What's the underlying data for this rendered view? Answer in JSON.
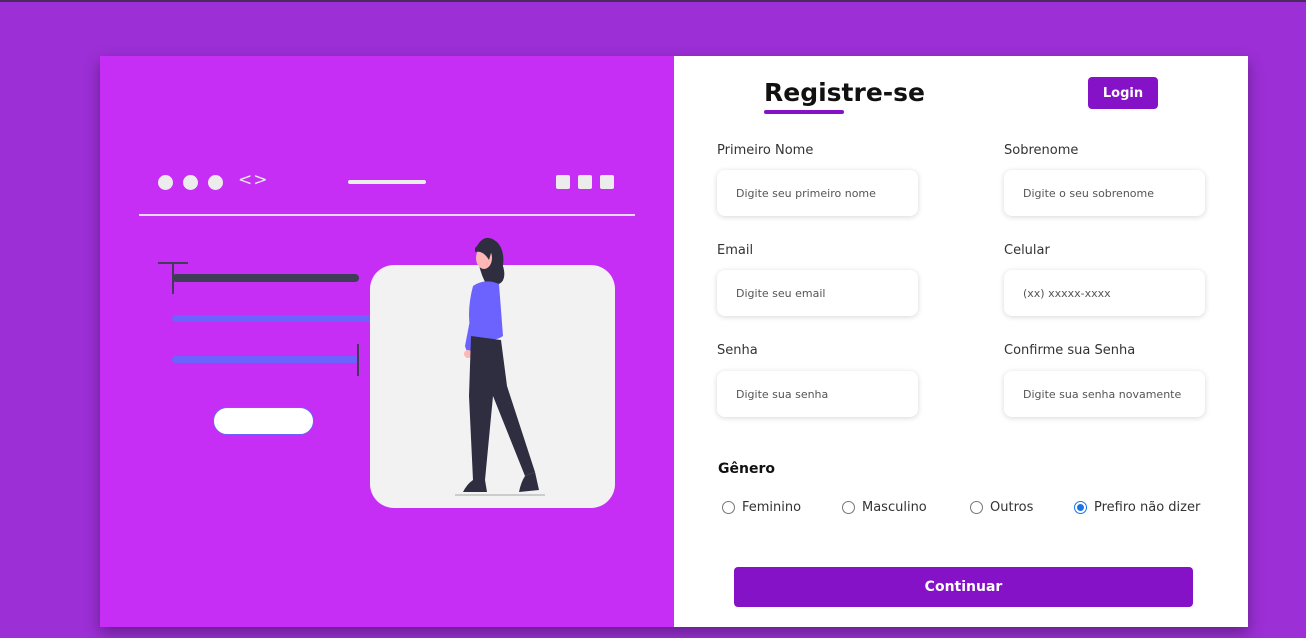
{
  "header": {
    "title": "Registre-se",
    "login_label": "Login"
  },
  "form": {
    "first_name": {
      "label": "Primeiro Nome",
      "placeholder": "Digite seu primeiro nome",
      "value": ""
    },
    "last_name": {
      "label": "Sobrenome",
      "placeholder": "Digite o seu sobrenome",
      "value": ""
    },
    "email": {
      "label": "Email",
      "placeholder": "Digite seu email",
      "value": ""
    },
    "phone": {
      "label": "Celular",
      "placeholder": "(xx) xxxxx-xxxx",
      "value": ""
    },
    "password": {
      "label": "Senha",
      "placeholder": "Digite sua senha",
      "value": ""
    },
    "confirm_password": {
      "label": "Confirme sua Senha",
      "placeholder": "Digite sua senha novamente",
      "value": ""
    }
  },
  "gender": {
    "title": "Gênero",
    "options": [
      "Feminino",
      "Masculino",
      "Outros",
      "Prefiro não dizer"
    ],
    "selected": "Prefiro não dizer"
  },
  "continue_label": "Continuar",
  "illustration": {
    "icons": [
      "window-dots-icon",
      "code-brackets-icon",
      "window-squares-icon",
      "text-cursor-icon",
      "person-illustration"
    ]
  },
  "colors": {
    "background": "#9c2fd6",
    "panel": "#c62ef5",
    "accent": "#8512c7",
    "illustration_blue": "#6c63ff",
    "illustration_dark": "#3f3d56"
  }
}
